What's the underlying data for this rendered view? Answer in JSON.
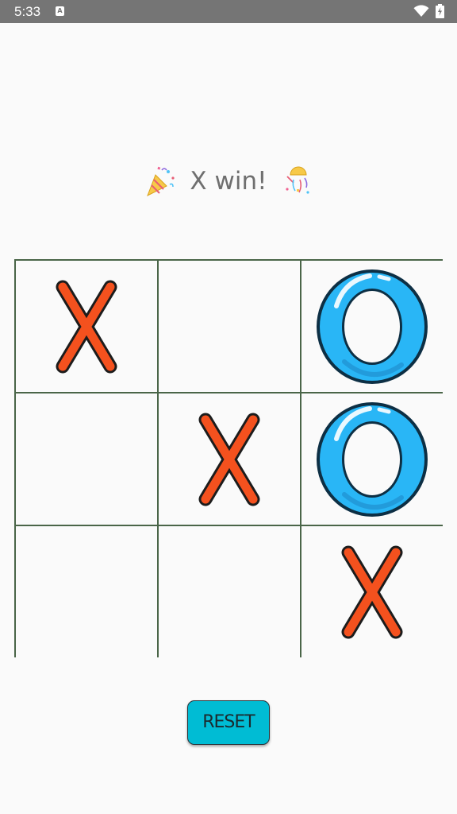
{
  "status_bar": {
    "time": "5:33",
    "notification_icon_letter": "A",
    "icons": [
      "wifi-icon",
      "battery-icon"
    ]
  },
  "game": {
    "result_text": "X win!",
    "left_emoji": "party-popper-icon",
    "right_emoji": "confetti-ball-icon",
    "board": [
      [
        "X",
        "",
        "O"
      ],
      [
        "",
        "X",
        "O"
      ],
      [
        "",
        "",
        "X"
      ]
    ],
    "colors": {
      "x": "#f4511e",
      "o": "#29b6f6",
      "grid": "#4a6548",
      "reset_button": "#00bcd4"
    }
  },
  "controls": {
    "reset_label": "RESET"
  }
}
